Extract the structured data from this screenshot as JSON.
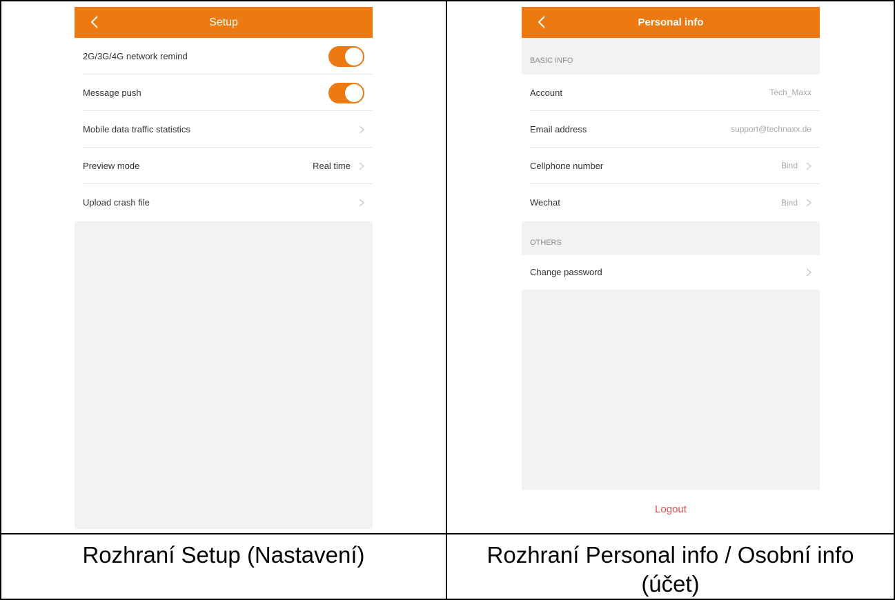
{
  "left_screen": {
    "title": "Setup",
    "rows": [
      {
        "label": "2G/3G/4G network remind",
        "type": "toggle"
      },
      {
        "label": "Message push",
        "type": "toggle"
      },
      {
        "label": "Mobile data traffic statistics",
        "type": "link"
      },
      {
        "label": "Preview mode",
        "type": "link",
        "value": "Real time"
      },
      {
        "label": "Upload crash file",
        "type": "link"
      }
    ],
    "toggles": {
      "network_remind": "on",
      "message_push": "on"
    }
  },
  "right_screen": {
    "title": "Personal info",
    "sections": {
      "basic_info": "BASIC INFO",
      "others": "OTHERS"
    },
    "rows": [
      {
        "label": "Account",
        "value": "Tech_Maxx"
      },
      {
        "label": "Email address",
        "value": "support@technaxx.de"
      },
      {
        "label": "Cellphone number",
        "value": "Bind"
      },
      {
        "label": "Wechat",
        "value": "Bind"
      },
      {
        "label": "Change password",
        "value": ""
      }
    ],
    "logout": "Logout"
  },
  "captions": {
    "left": "Rozhraní Setup (Nastavení)",
    "right_line1": "Rozhraní Personal info / Osobní info",
    "right_line2": "(účet)"
  },
  "colors": {
    "accent": "#ec7a10",
    "background": "#f2f2f3",
    "logout": "#e05050"
  },
  "icons": [
    "back-chevron-icon",
    "chevron-right-icon",
    "toggle-switch"
  ]
}
